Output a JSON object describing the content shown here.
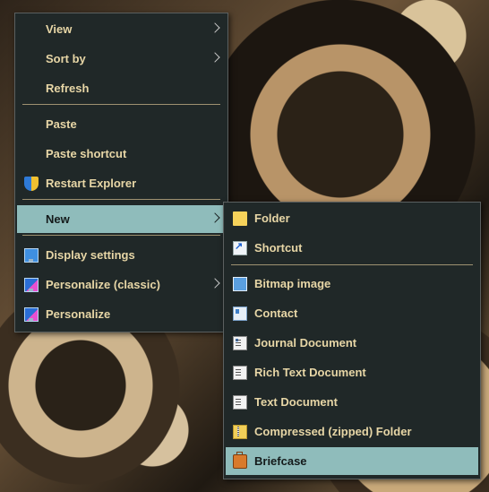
{
  "context_menu": {
    "items": [
      {
        "label": "View"
      },
      {
        "label": "Sort by"
      },
      {
        "label": "Refresh"
      },
      {
        "label": "Paste"
      },
      {
        "label": "Paste shortcut"
      },
      {
        "label": "Restart Explorer",
        "icon": "shield-icon"
      },
      {
        "label": "New"
      },
      {
        "label": "Display settings",
        "icon": "display-icon"
      },
      {
        "label": "Personalize (classic)",
        "icon": "personalize-icon"
      },
      {
        "label": "Personalize",
        "icon": "personalize-icon"
      }
    ]
  },
  "new_submenu": {
    "items": [
      {
        "label": "Folder",
        "icon": "folder-icon"
      },
      {
        "label": "Shortcut",
        "icon": "shortcut-icon"
      },
      {
        "label": "Bitmap image",
        "icon": "bitmap-icon"
      },
      {
        "label": "Contact",
        "icon": "contact-icon"
      },
      {
        "label": "Journal Document",
        "icon": "journal-icon"
      },
      {
        "label": "Rich Text Document",
        "icon": "rich-text-icon"
      },
      {
        "label": "Text Document",
        "icon": "text-document-icon"
      },
      {
        "label": "Compressed (zipped) Folder",
        "icon": "zip-folder-icon"
      },
      {
        "label": "Briefcase",
        "icon": "briefcase-icon"
      }
    ]
  },
  "colors": {
    "menu_background": "#202828",
    "highlight": "#8fbcbb",
    "text": "#e7d6a6"
  }
}
